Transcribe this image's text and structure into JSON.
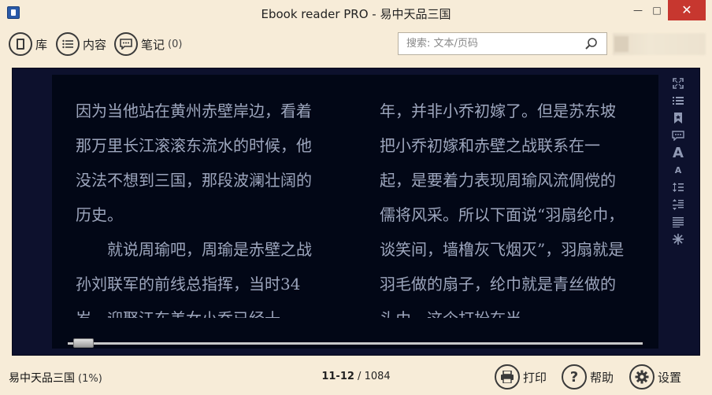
{
  "window": {
    "title": "Ebook reader PRO - 易中天品三国",
    "minimize": "—",
    "maximize": "□",
    "close": "✕"
  },
  "toolbar": {
    "library_label": "库",
    "contents_label": "内容",
    "notes_label": "笔记",
    "notes_count": "(0)",
    "search_placeholder": "搜索: 文本/页码"
  },
  "book": {
    "left_column": "因为当他站在黄州赤壁岸边，看着那万里长江滚滚东流水的时候，他没法不想到三国，那段波澜壮阔的历史。\n　　就说周瑜吧，周瑜是赤壁之战孙刘联军的前线总指挥，当时34岁，迎娶江东美女小乔已经十",
    "right_column": "年，并非小乔初嫁了。但是苏东坡把小乔初嫁和赤壁之战联系在一起，是要着力表现周瑜风流倜傥的儒将风采。所以下面说“羽扇纶巾，谈笑间，墙橹灰飞烟灭”，羽扇就是羽毛做的扇子，纶巾就是青丝做的头巾，这个打扮在当",
    "progress": 0.01
  },
  "side_tools": [
    "fullscreen-icon",
    "toc-icon",
    "bookmark-icon",
    "comment-icon",
    "font-larger-icon",
    "font-smaller-icon",
    "line-spacing-icon",
    "paragraph-spacing-icon",
    "justify-icon",
    "brightness-icon"
  ],
  "status": {
    "book_title": "易中天品三国",
    "percent": "(1%)",
    "page_current": "11-12",
    "page_separator": " / ",
    "page_total": "1084",
    "print_label": "打印",
    "help_label": "帮助",
    "settings_label": "设置"
  },
  "colors": {
    "background": "#f7ecd8",
    "reader_bg": "#020716",
    "reader_text": "#9da6bd",
    "close_button": "#c7372f"
  }
}
